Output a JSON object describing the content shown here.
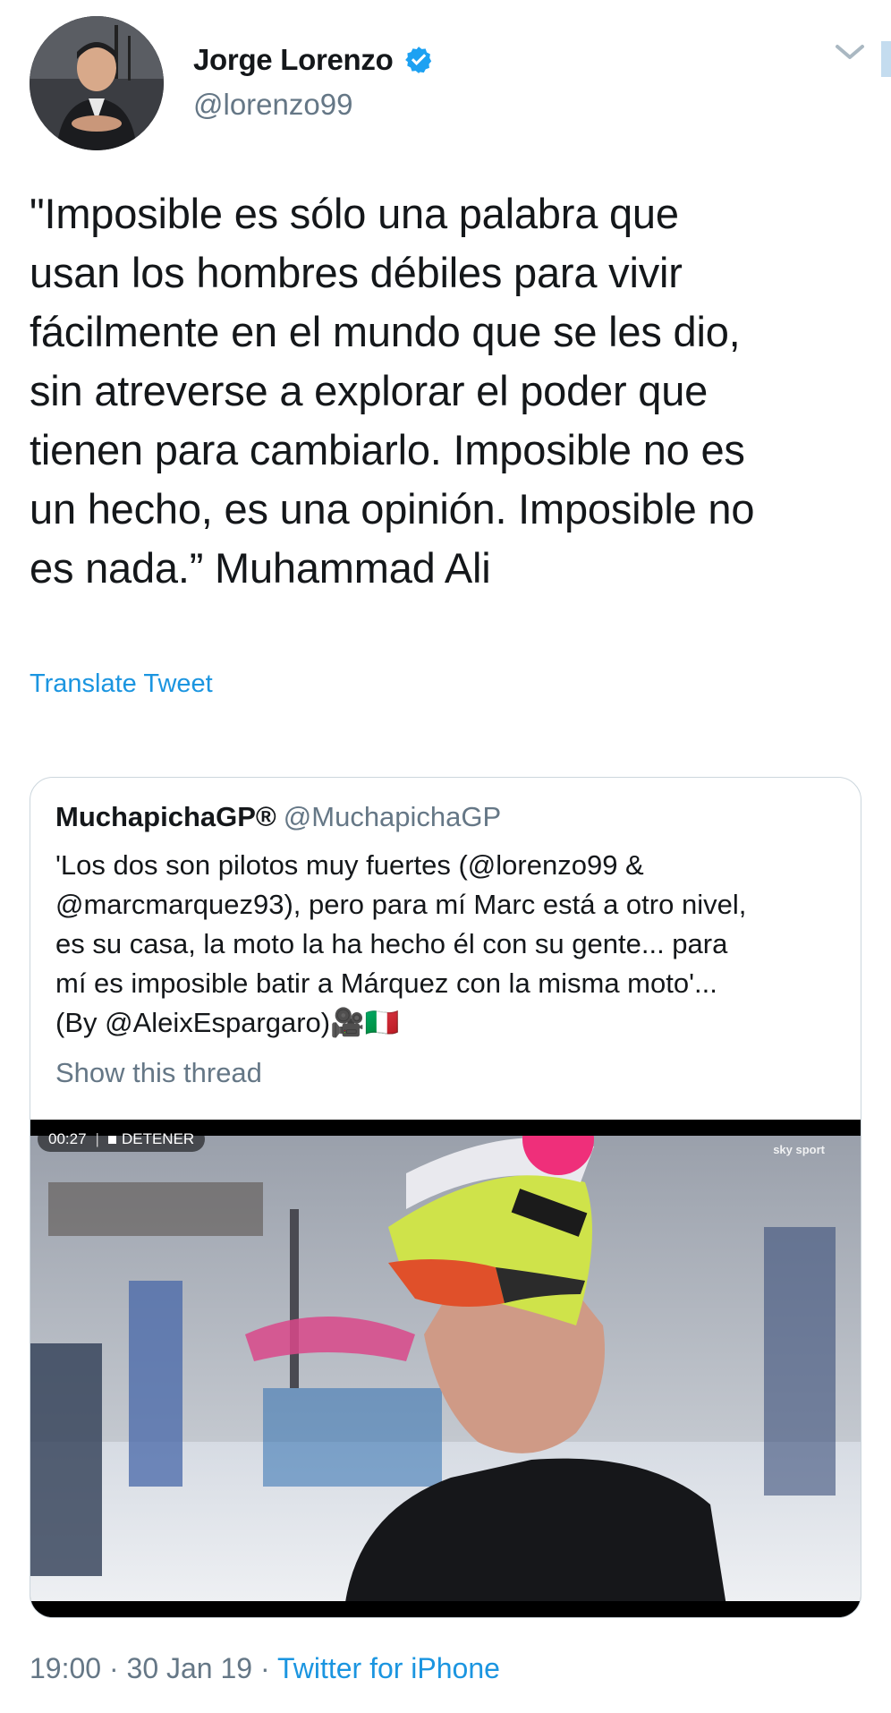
{
  "tweet": {
    "author_name": "Jorge Lorenzo",
    "author_handle": "@lorenzo99",
    "verified_icon": "verified-badge-icon",
    "menu_icon": "chevron-down-icon",
    "text": "\"Imposible es sólo una palabra que\nusan los hombres débiles para vivir\nfácilmente en el mundo que se les dio,\nsin atreverse a explorar el poder que\ntienen para cambiarlo. Imposible no es\nun hecho, es una opinión. Imposible no\nes nada.” Muhammad Ali",
    "translate_label": "Translate Tweet"
  },
  "quoted": {
    "author_name": "MuchapichaGP®",
    "author_handle": "@MuchapichaGP",
    "text": "'Los dos son pilotos muy fuertes (@lorenzo99 &\n@marcmarquez93), pero para mí Marc está a otro nivel,\nes su casa, la moto la ha hecho él con su gente... para\nmí es imposible batir a Márquez con la misma moto'...\n(By @AleixEspargaro)🎥🇮🇹",
    "show_thread": "Show this thread",
    "video": {
      "elapsed": "00:27",
      "stop_label": "DETENER",
      "channel_logo": "sky sport"
    }
  },
  "footer": {
    "time": "19:00",
    "date": "30 Jan 19",
    "separator": " · ",
    "source": "Twitter for iPhone"
  },
  "colors": {
    "link": "#1b95e0",
    "secondary_text": "#657786",
    "primary_text": "#14171a",
    "border": "#ccd6dd"
  }
}
